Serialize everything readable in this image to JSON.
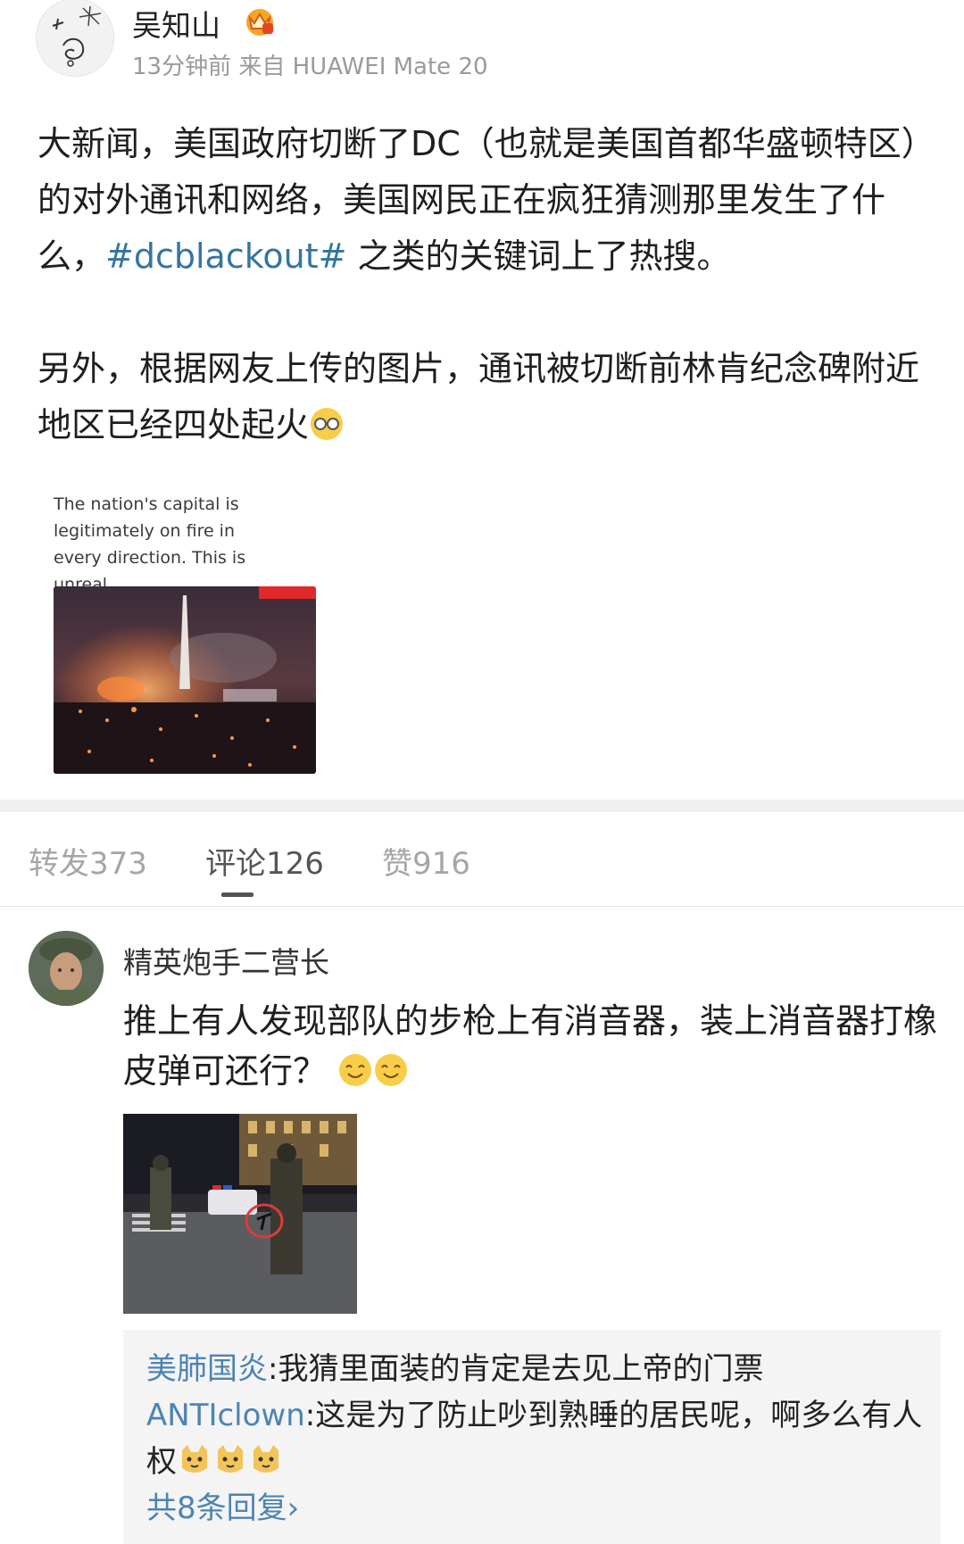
{
  "post": {
    "username": "吴知山",
    "meta": "13分钟前 来自 HUAWEI Mate 20",
    "text_p1_a": "大新闻，美国政府切断了DC（也就是美国首都华盛顿特区）的对外通讯和网络，美国网民正在疯狂猜测那里发生了什么，",
    "hashtag": "#dcblackout#",
    "text_p1_b": " 之类的关键词上了热搜。",
    "text_p2": "另外，根据网友上传的图片，通讯被切断前林肯纪念碑附近地区已经四处起火",
    "image_caption": "The nation's capital is legitimately on fire in every direction. This is unreal."
  },
  "tabs": [
    {
      "label": "转发373"
    },
    {
      "label": "评论126"
    },
    {
      "label": "赞916"
    }
  ],
  "active_tab": 1,
  "comment": {
    "username": "精英炮手二营长",
    "text": "推上有人发现部队的步枪上有消音器，装上消音器打橡皮弹可还行？"
  },
  "replies": [
    {
      "user": "美肺国炎",
      "text": ":我猜里面装的肯定是去见上帝的门票"
    },
    {
      "user": "ANTIclown",
      "text": ":这是为了防止吵到熟睡的居民呢，啊多么有人权"
    }
  ],
  "more_replies": "共8条回复›",
  "colors": {
    "link": "#4d83b4",
    "hashtag": "#34759f",
    "muted": "#9a9a9a",
    "separator": "#f0f0f0"
  },
  "icons": [
    "avatar-doodle",
    "vip-crown-badge",
    "sunglasses-emoji",
    "smile-emoji",
    "cat-face-emoji",
    "chevron-right-icon"
  ]
}
